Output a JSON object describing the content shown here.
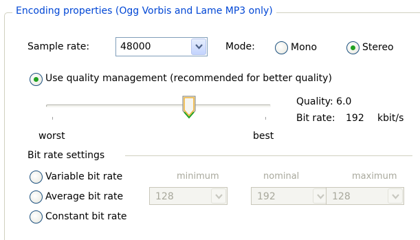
{
  "group": {
    "title": "Encoding properties (Ogg Vorbis and Lame MP3 only)"
  },
  "sample_rate": {
    "label": "Sample rate:",
    "value": "48000"
  },
  "mode": {
    "label": "Mode:",
    "options": [
      {
        "label": "Mono",
        "selected": false
      },
      {
        "label": "Stereo",
        "selected": true
      }
    ]
  },
  "quality_management": {
    "label": "Use quality management (recommended for better quality)",
    "selected": true,
    "slider": {
      "min_label": "worst",
      "max_label": "best",
      "level": 0.6
    },
    "quality_text": "Quality: 6.0",
    "bitrate_label": "Bit rate:",
    "bitrate_value": "192",
    "bitrate_unit": "kbit/s"
  },
  "bitrate_settings": {
    "heading": "Bit rate settings",
    "options": [
      {
        "label": "Variable bit rate",
        "selected": false
      },
      {
        "label": "Average bit rate",
        "selected": false
      },
      {
        "label": "Constant bit rate",
        "selected": false
      }
    ],
    "minimum": {
      "label": "minimum",
      "value": "128"
    },
    "nominal": {
      "label": "nominal",
      "value": "192"
    },
    "maximum": {
      "label": "maximum",
      "value": "128"
    }
  },
  "colors": {
    "accent": "#0046d5",
    "radio_dot": "#21a121",
    "disabled_text": "#a8a89c"
  },
  "icons": {
    "dropdown": "chevron-down-icon",
    "slider_thumb": "slider-thumb-icon"
  }
}
